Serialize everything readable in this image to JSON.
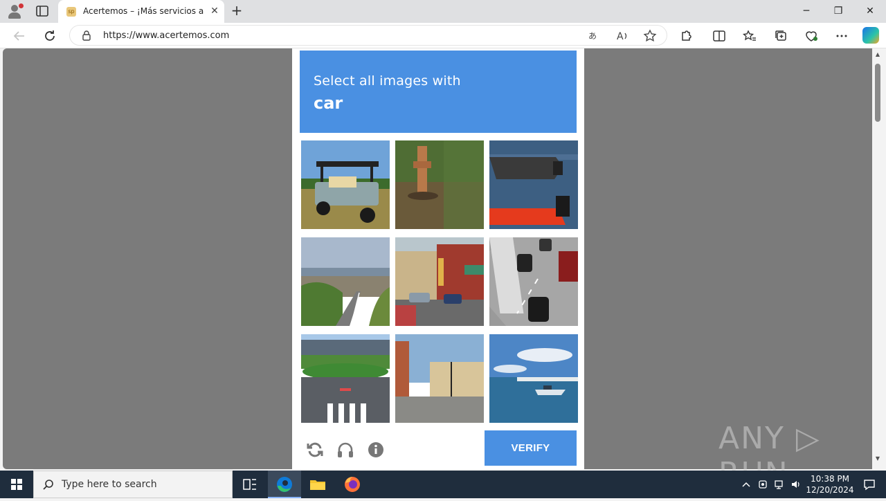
{
  "browser": {
    "tab": {
      "title": "Acertemos – ¡Más servicios a tu al",
      "favicon_text": "sp",
      "close": "✕"
    },
    "new_tab": "+",
    "window": {
      "minimize": "─",
      "restore": "❐",
      "close": "✕"
    },
    "address": {
      "url": "https://www.acertemos.com"
    }
  },
  "captcha": {
    "prompt_line1": "Select all images with",
    "prompt_target": "car",
    "tiles": [
      "golf-cart",
      "fire-hydrant",
      "boats",
      "coastal-road",
      "town-street",
      "highway-cars",
      "crosswalk-intersection",
      "plaza-street",
      "sea-boat"
    ],
    "verify_label": "VERIFY"
  },
  "watermark": "ANY ▷ RUN",
  "taskbar": {
    "search_placeholder": "Type here to search",
    "time": "10:38 PM",
    "date": "12/20/2024"
  },
  "colors": {
    "captcha_blue": "#4a90e2",
    "page_gray": "#7b7b7b",
    "taskbar": "#1f2d3d"
  }
}
